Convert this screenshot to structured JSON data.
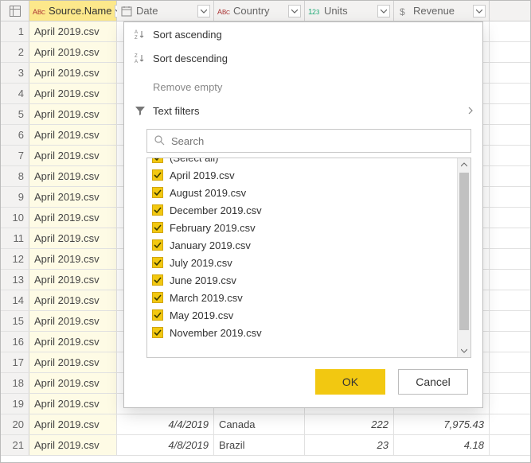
{
  "columns": {
    "source": "Source.Name",
    "date": "Date",
    "country": "Country",
    "units": "Units",
    "revenue": "Revenue"
  },
  "rows": [
    {
      "n": "1",
      "source": "April 2019.csv",
      "date": "",
      "country": "",
      "units": "",
      "revenue": ""
    },
    {
      "n": "2",
      "source": "April 2019.csv",
      "date": "",
      "country": "",
      "units": "",
      "revenue": ""
    },
    {
      "n": "3",
      "source": "April 2019.csv",
      "date": "",
      "country": "",
      "units": "",
      "revenue": ""
    },
    {
      "n": "4",
      "source": "April 2019.csv",
      "date": "",
      "country": "",
      "units": "",
      "revenue": ""
    },
    {
      "n": "5",
      "source": "April 2019.csv",
      "date": "",
      "country": "",
      "units": "",
      "revenue": ""
    },
    {
      "n": "6",
      "source": "April 2019.csv",
      "date": "",
      "country": "",
      "units": "",
      "revenue": ""
    },
    {
      "n": "7",
      "source": "April 2019.csv",
      "date": "",
      "country": "",
      "units": "",
      "revenue": ""
    },
    {
      "n": "8",
      "source": "April 2019.csv",
      "date": "",
      "country": "",
      "units": "",
      "revenue": ""
    },
    {
      "n": "9",
      "source": "April 2019.csv",
      "date": "",
      "country": "",
      "units": "",
      "revenue": ""
    },
    {
      "n": "10",
      "source": "April 2019.csv",
      "date": "",
      "country": "",
      "units": "",
      "revenue": ""
    },
    {
      "n": "11",
      "source": "April 2019.csv",
      "date": "",
      "country": "",
      "units": "",
      "revenue": ""
    },
    {
      "n": "12",
      "source": "April 2019.csv",
      "date": "",
      "country": "",
      "units": "",
      "revenue": ""
    },
    {
      "n": "13",
      "source": "April 2019.csv",
      "date": "",
      "country": "",
      "units": "",
      "revenue": ""
    },
    {
      "n": "14",
      "source": "April 2019.csv",
      "date": "",
      "country": "",
      "units": "",
      "revenue": ""
    },
    {
      "n": "15",
      "source": "April 2019.csv",
      "date": "",
      "country": "",
      "units": "",
      "revenue": ""
    },
    {
      "n": "16",
      "source": "April 2019.csv",
      "date": "",
      "country": "",
      "units": "",
      "revenue": ""
    },
    {
      "n": "17",
      "source": "April 2019.csv",
      "date": "",
      "country": "",
      "units": "",
      "revenue": ""
    },
    {
      "n": "18",
      "source": "April 2019.csv",
      "date": "",
      "country": "",
      "units": "",
      "revenue": ""
    },
    {
      "n": "19",
      "source": "April 2019.csv",
      "date": "",
      "country": "",
      "units": "",
      "revenue": ""
    },
    {
      "n": "20",
      "source": "April 2019.csv",
      "date": "4/4/2019",
      "country": "Canada",
      "units": "222",
      "revenue": "7,975.43"
    },
    {
      "n": "21",
      "source": "April 2019.csv",
      "date": "4/8/2019",
      "country": "Brazil",
      "units": "23",
      "revenue": "4.18"
    }
  ],
  "menu": {
    "sort_asc": "Sort ascending",
    "sort_desc": "Sort descending",
    "remove_empty": "Remove empty",
    "text_filters": "Text filters"
  },
  "search": {
    "placeholder": "Search"
  },
  "filter_items": [
    "(Select all)",
    "April 2019.csv",
    "August 2019.csv",
    "December 2019.csv",
    "February 2019.csv",
    "January 2019.csv",
    "July 2019.csv",
    "June 2019.csv",
    "March 2019.csv",
    "May 2019.csv",
    "November 2019.csv"
  ],
  "buttons": {
    "ok": "OK",
    "cancel": "Cancel"
  }
}
